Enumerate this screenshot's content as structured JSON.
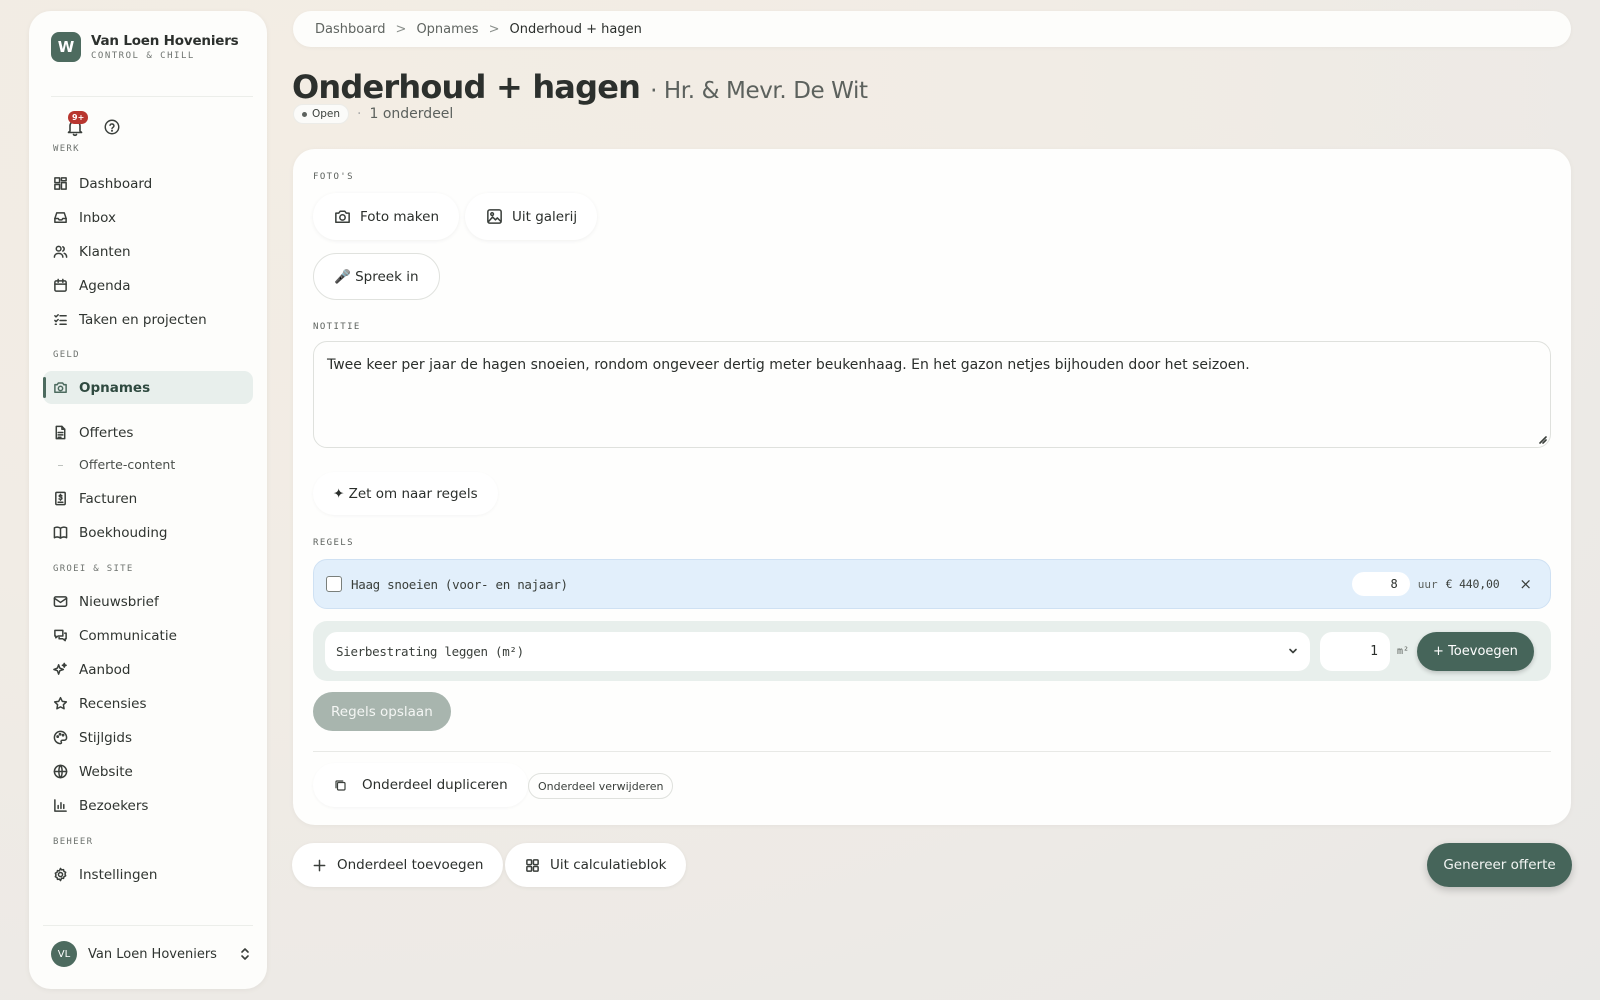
{
  "brand": {
    "logo_letter": "W",
    "name": "Van Loen Hoveniers",
    "tagline": "CONTROL & CHILL"
  },
  "notifications": {
    "badge": "9+"
  },
  "sidebar": {
    "sections": {
      "werk": "WERK",
      "geld": "GELD",
      "groei": "GROEI & SITE",
      "beheer": "BEHEER"
    },
    "items": {
      "dashboard": "Dashboard",
      "inbox": "Inbox",
      "klanten": "Klanten",
      "agenda": "Agenda",
      "taken": "Taken en projecten",
      "opnames": "Opnames",
      "offertes": "Offertes",
      "offerte_content": "Offerte-content",
      "facturen": "Facturen",
      "boekhouding": "Boekhouding",
      "nieuwsbrief": "Nieuwsbrief",
      "communicatie": "Communicatie",
      "aanbod": "Aanbod",
      "recensies": "Recensies",
      "stijlgids": "Stijlgids",
      "website": "Website",
      "bezoekers": "Bezoekers",
      "instellingen": "Instellingen"
    },
    "active": "opnames"
  },
  "user": {
    "initials": "VL",
    "name": "Van Loen Hoveniers"
  },
  "breadcrumb": {
    "items": [
      "Dashboard",
      "Opnames",
      "Onderhoud + hagen"
    ],
    "separator": ">"
  },
  "page": {
    "title": "Onderhoud + hagen",
    "client": "· Hr. & Mevr. De Wit",
    "status": "Open",
    "count": "1 onderdeel"
  },
  "card": {
    "photos_label": "FOTO'S",
    "photo_button": "Foto maken",
    "gallery_button": "Uit galerij",
    "speak_button": "🎤 Spreek in",
    "note_label": "NOTITIE",
    "note_text": "Twee keer per jaar de hagen snoeien, rondom ongeveer dertig meter beukenhaag. En het gazon netjes bijhouden door het seizoen.",
    "convert_button": "✦ Zet om naar regels",
    "rules_label": "REGELS",
    "line_item": {
      "description": "Haag snoeien (voor- en najaar)",
      "quantity": "8",
      "unit": "uur",
      "price": "€ 440,00",
      "remove": "×"
    },
    "add_row": {
      "selected": "Sierbestrating leggen (m²)",
      "quantity": "1",
      "unit": "m²",
      "add_button": "+ Toevoegen"
    },
    "save_button": "Regels opslaan",
    "duplicate_button": "Onderdeel dupliceren",
    "delete_button": "Onderdeel verwijderen"
  },
  "bottom": {
    "add_part": "Onderdeel toevoegen",
    "from_calc": "Uit calculatieblok",
    "generate": "Genereer offerte"
  },
  "colors": {
    "accent": "#46655a",
    "active_bg": "#e8efec",
    "line_bg": "#e2effb",
    "badge": "#b8362f"
  }
}
